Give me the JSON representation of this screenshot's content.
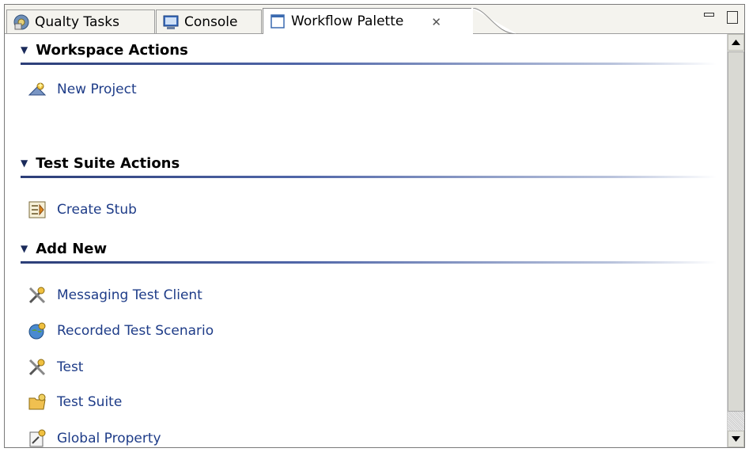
{
  "tabs": [
    {
      "label": "Qualty Tasks",
      "icon": "tasks-icon"
    },
    {
      "label": "Console",
      "icon": "console-icon"
    },
    {
      "label": "Workflow Palette",
      "icon": "palette-icon",
      "active": true
    }
  ],
  "sections": [
    {
      "title": "Workspace Actions",
      "items": [
        {
          "label": "New Project",
          "icon": "new-project-icon"
        }
      ]
    },
    {
      "title": "Test Suite Actions",
      "items": [
        {
          "label": "Create Stub",
          "icon": "create-stub-icon"
        }
      ]
    },
    {
      "title": "Add New",
      "items": [
        {
          "label": "Messaging Test Client",
          "icon": "test-client-icon"
        },
        {
          "label": "Recorded Test Scenario",
          "icon": "recorded-scenario-icon"
        },
        {
          "label": "Test",
          "icon": "test-icon"
        },
        {
          "label": "Test Suite",
          "icon": "test-suite-icon"
        },
        {
          "label": "Global Property",
          "icon": "global-property-icon"
        }
      ]
    }
  ],
  "colors": {
    "link": "#1e3c88",
    "rule": "#2c3e78",
    "tabbar": "#f4f3ee"
  }
}
